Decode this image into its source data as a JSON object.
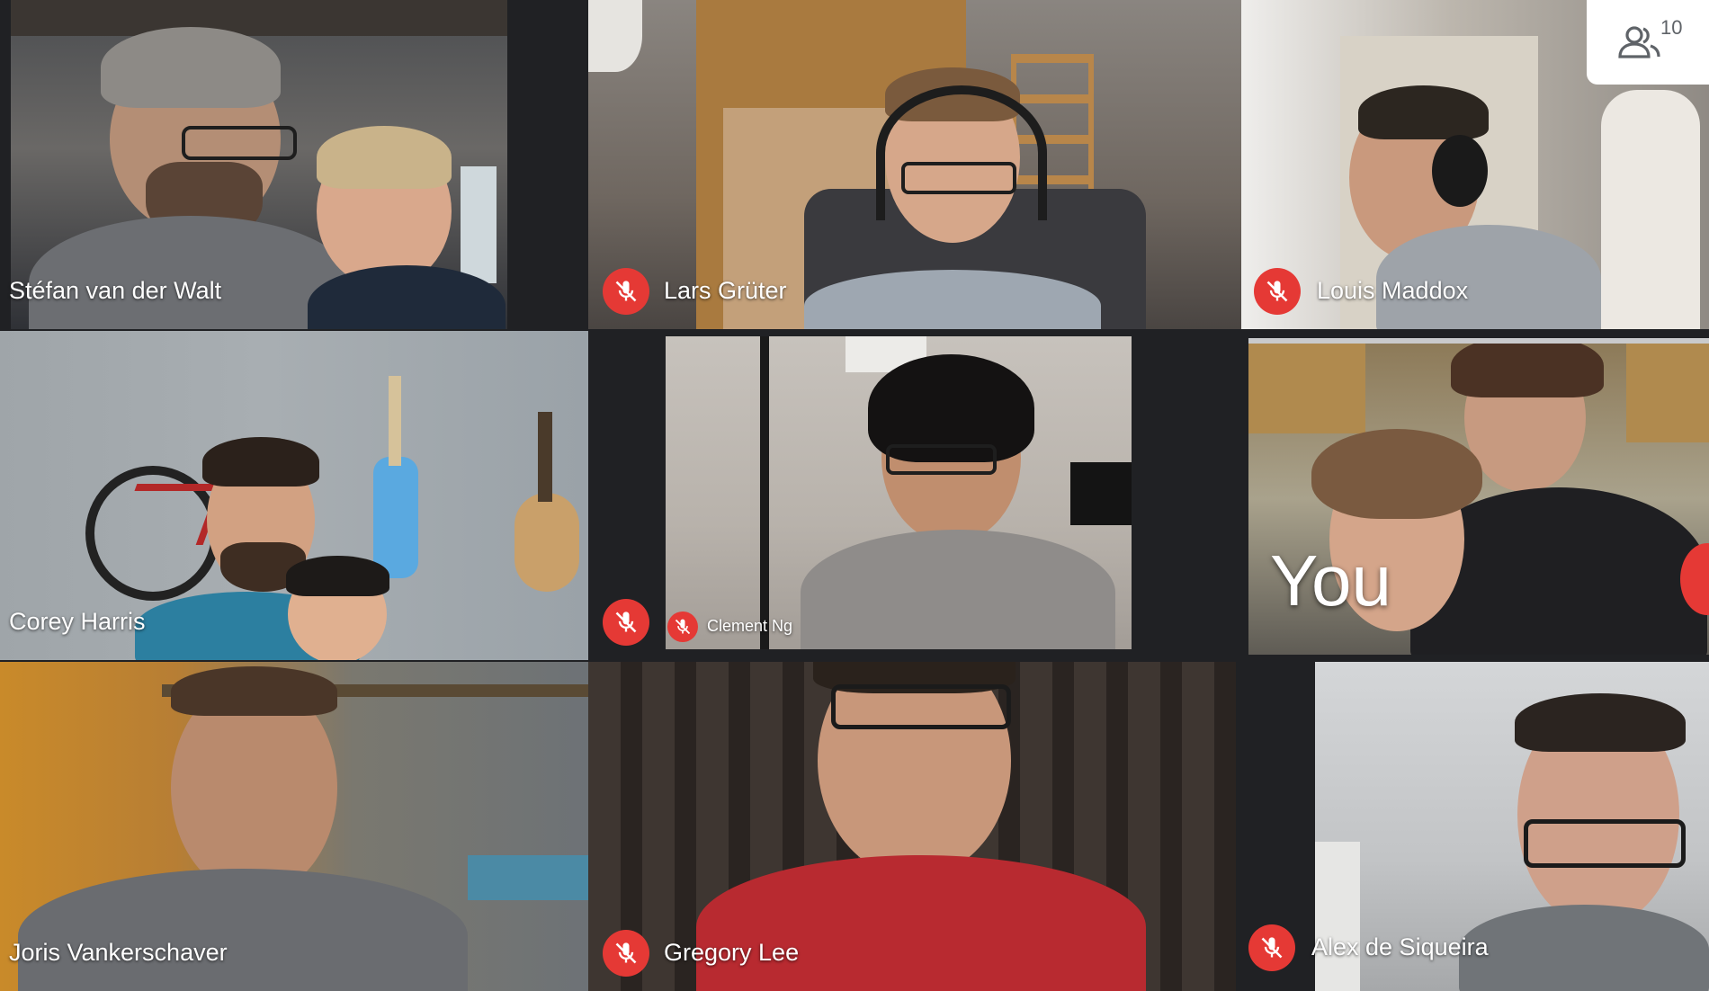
{
  "participants_button": {
    "icon": "people-icon",
    "count": "10"
  },
  "tiles": [
    {
      "name": "Stéfan van der Walt",
      "muted": false
    },
    {
      "name": "Lars Grüter",
      "muted": true
    },
    {
      "name": "Louis Maddox",
      "muted": true
    },
    {
      "name": "Corey Harris",
      "muted": false
    },
    {
      "name": "Clement Ng",
      "muted": true
    },
    {
      "name": "You",
      "muted": false
    },
    {
      "name": "Joris Vankerschaver",
      "muted": false
    },
    {
      "name": "Gregory Lee",
      "muted": true
    },
    {
      "name": "Alex de Siqueira",
      "muted": true
    }
  ],
  "colors": {
    "background": "#202124",
    "mute_badge": "#e53935",
    "label_text": "#ffffff"
  }
}
